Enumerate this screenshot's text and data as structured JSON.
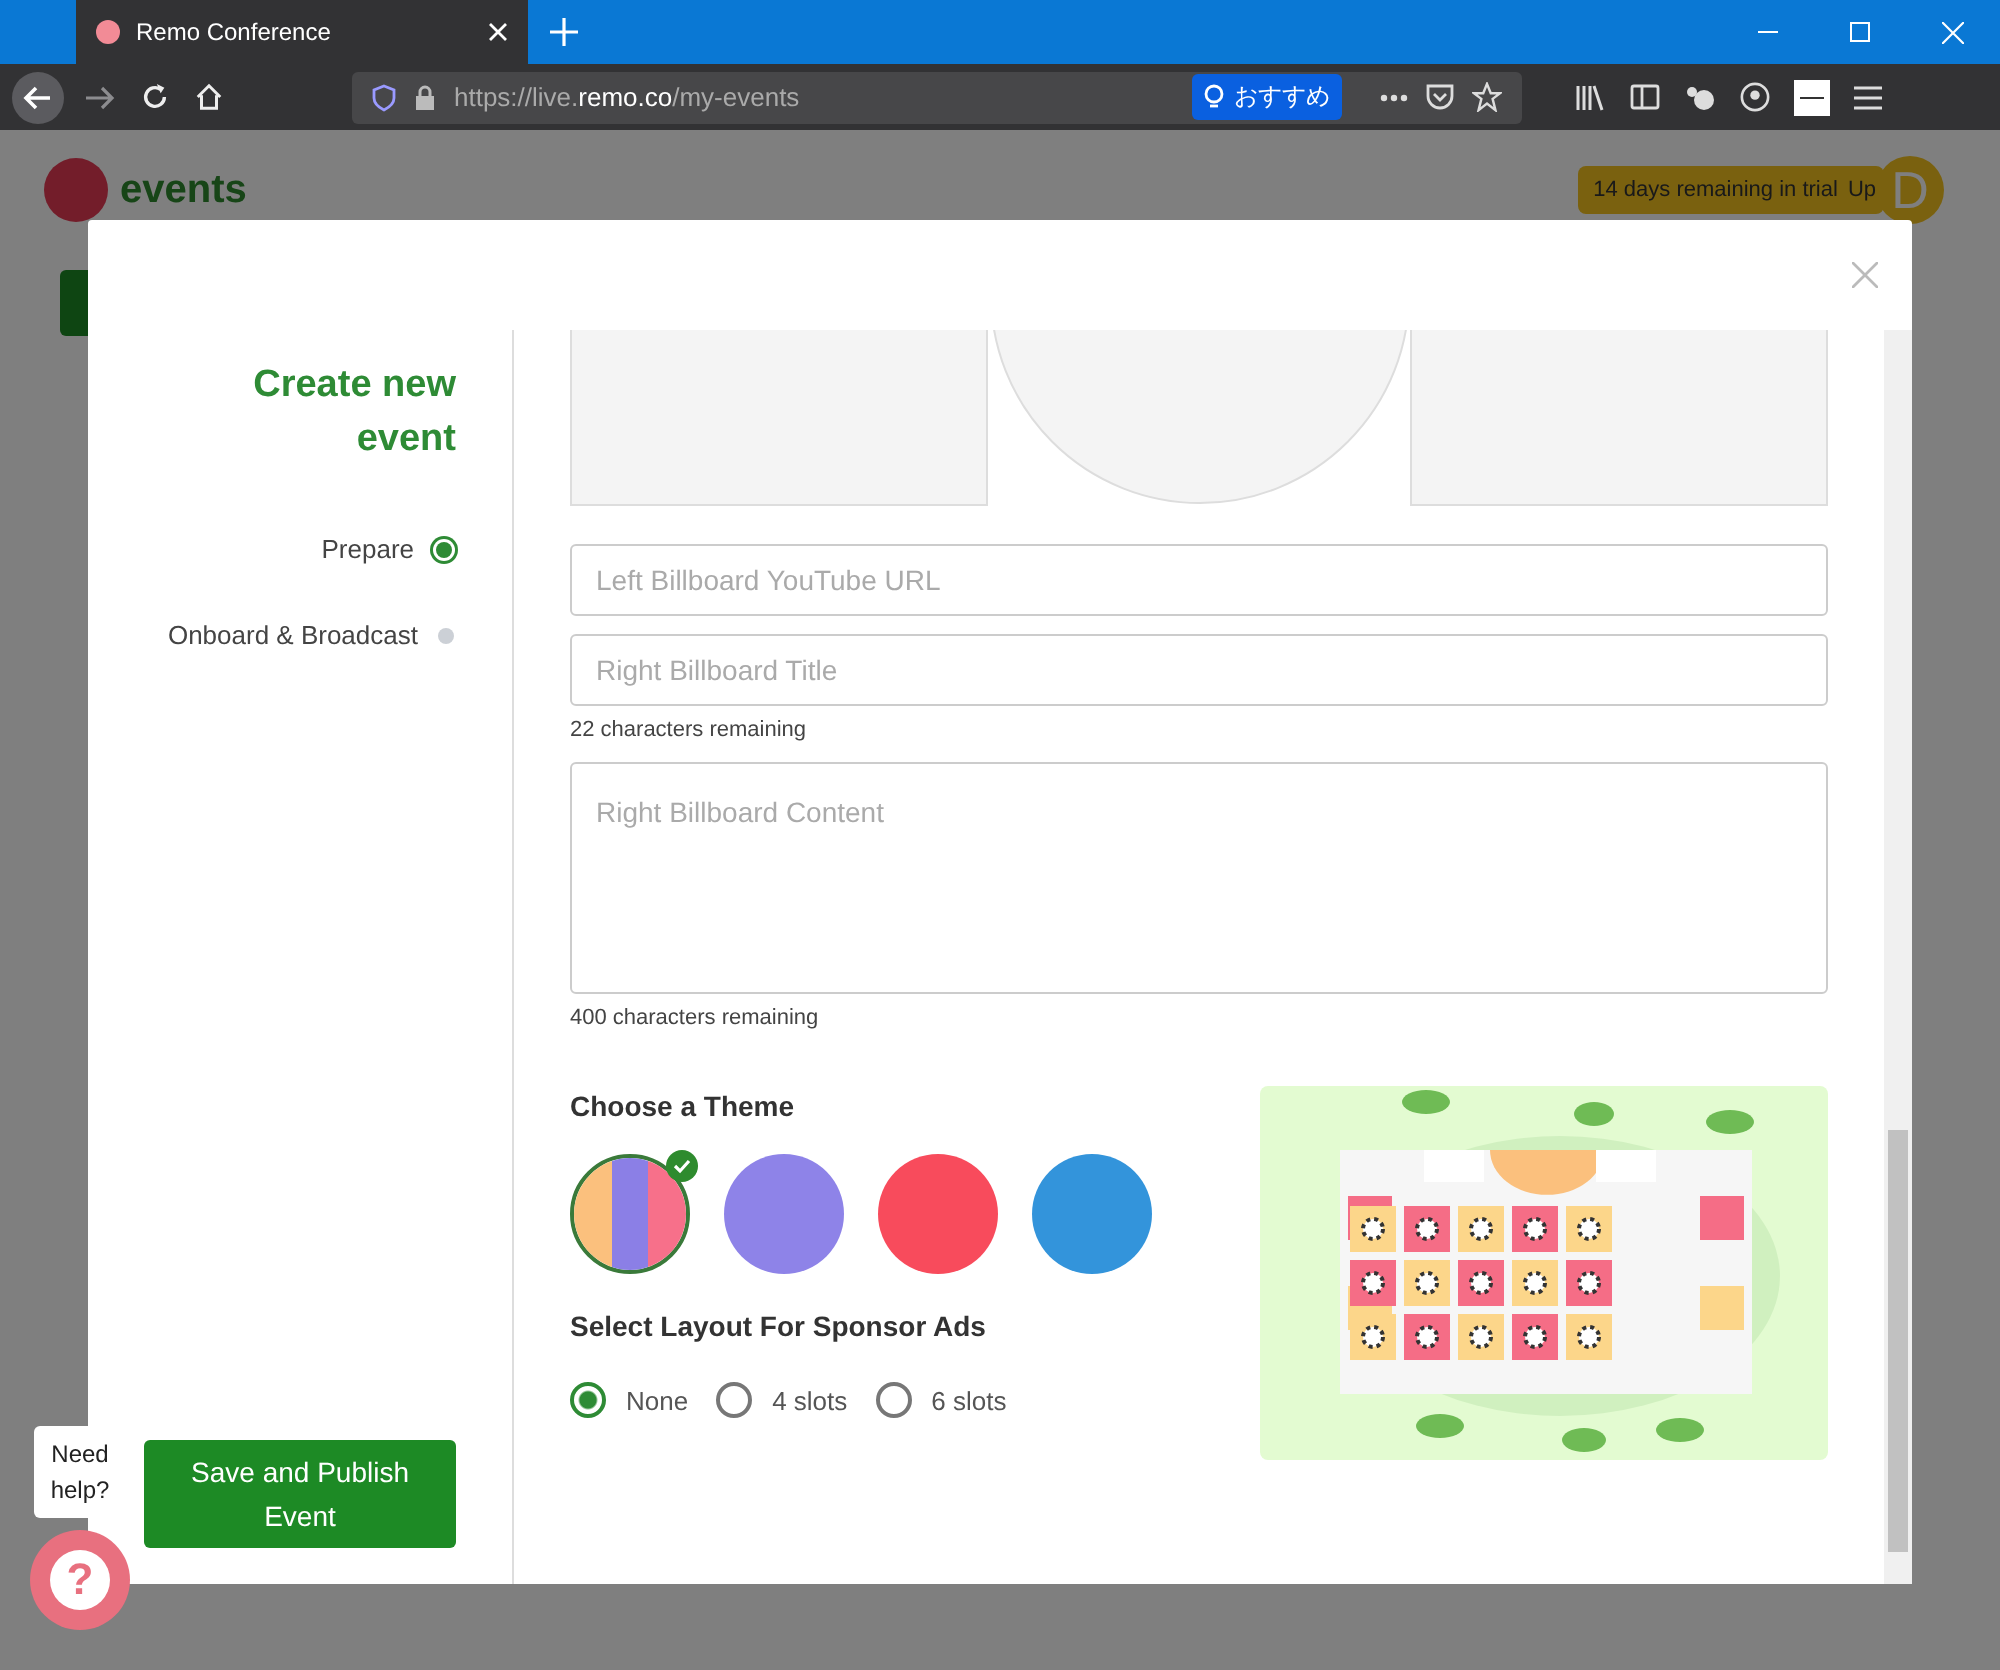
{
  "browser": {
    "tab_title": "Remo Conference",
    "url_prefix": "https://live.",
    "url_domain": "remo.co",
    "url_path": "/my-events",
    "recommend_label": "おすすめ"
  },
  "page": {
    "logo_text": "events",
    "trial_badge": "14 days remaining in trial",
    "upgrade_link": "Up",
    "avatar_letter": "D"
  },
  "modal": {
    "title": "Create new event",
    "steps": [
      {
        "label": "Prepare",
        "selected": true
      },
      {
        "label": "Onboard & Broadcast",
        "selected": false
      }
    ],
    "fields": [
      {
        "placeholder": "Left Billboard YouTube URL",
        "kind": "input"
      },
      {
        "placeholder": "Right Billboard Title",
        "kind": "input",
        "counter": "22 characters remaining"
      },
      {
        "placeholder": "Right Billboard Content",
        "kind": "textarea",
        "counter": "400 characters remaining"
      }
    ],
    "theme_heading": "Choose a Theme",
    "themes": [
      {
        "kind": "striped",
        "stripes": [
          {
            "color": "#fbc07d"
          },
          {
            "color": "#8b7fe6"
          },
          {
            "color": "#f7708a"
          }
        ],
        "selected": true
      },
      {
        "kind": "solid",
        "color": "#8e83e8",
        "selected": false
      },
      {
        "kind": "solid",
        "color": "#f84b5c",
        "selected": false
      },
      {
        "kind": "solid",
        "color": "#3394db",
        "selected": false
      }
    ],
    "layout_heading": "Select Layout For Sponsor Ads",
    "layouts": [
      {
        "label": "None",
        "selected": true
      },
      {
        "label": "4 slots",
        "selected": false
      },
      {
        "label": "6 slots",
        "selected": false
      }
    ],
    "save_button": "Save and Publish Event"
  },
  "help": {
    "bubble": "Need help?",
    "icon_glyph": "?"
  }
}
